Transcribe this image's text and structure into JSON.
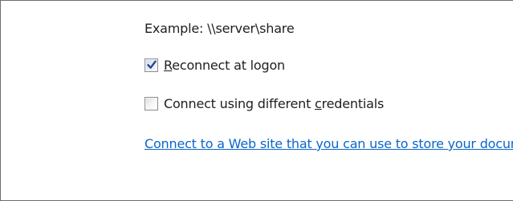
{
  "example_text": "Example: \\\\server\\share",
  "options": {
    "reconnect": {
      "label_access_key": "R",
      "label_rest": "econnect at logon",
      "checked": true
    },
    "credentials": {
      "label_before": "Connect using different ",
      "label_access_key": "c",
      "label_after": "redentials",
      "checked": false
    }
  },
  "web_link": {
    "text": "Connect to a Web site that you can use to store your documents and pictures."
  },
  "icons": {
    "checkmark": "checkmark-icon"
  },
  "colors": {
    "link": "#0b66cc",
    "text": "#1e1e1e",
    "checkmark": "#2b4a8b"
  }
}
